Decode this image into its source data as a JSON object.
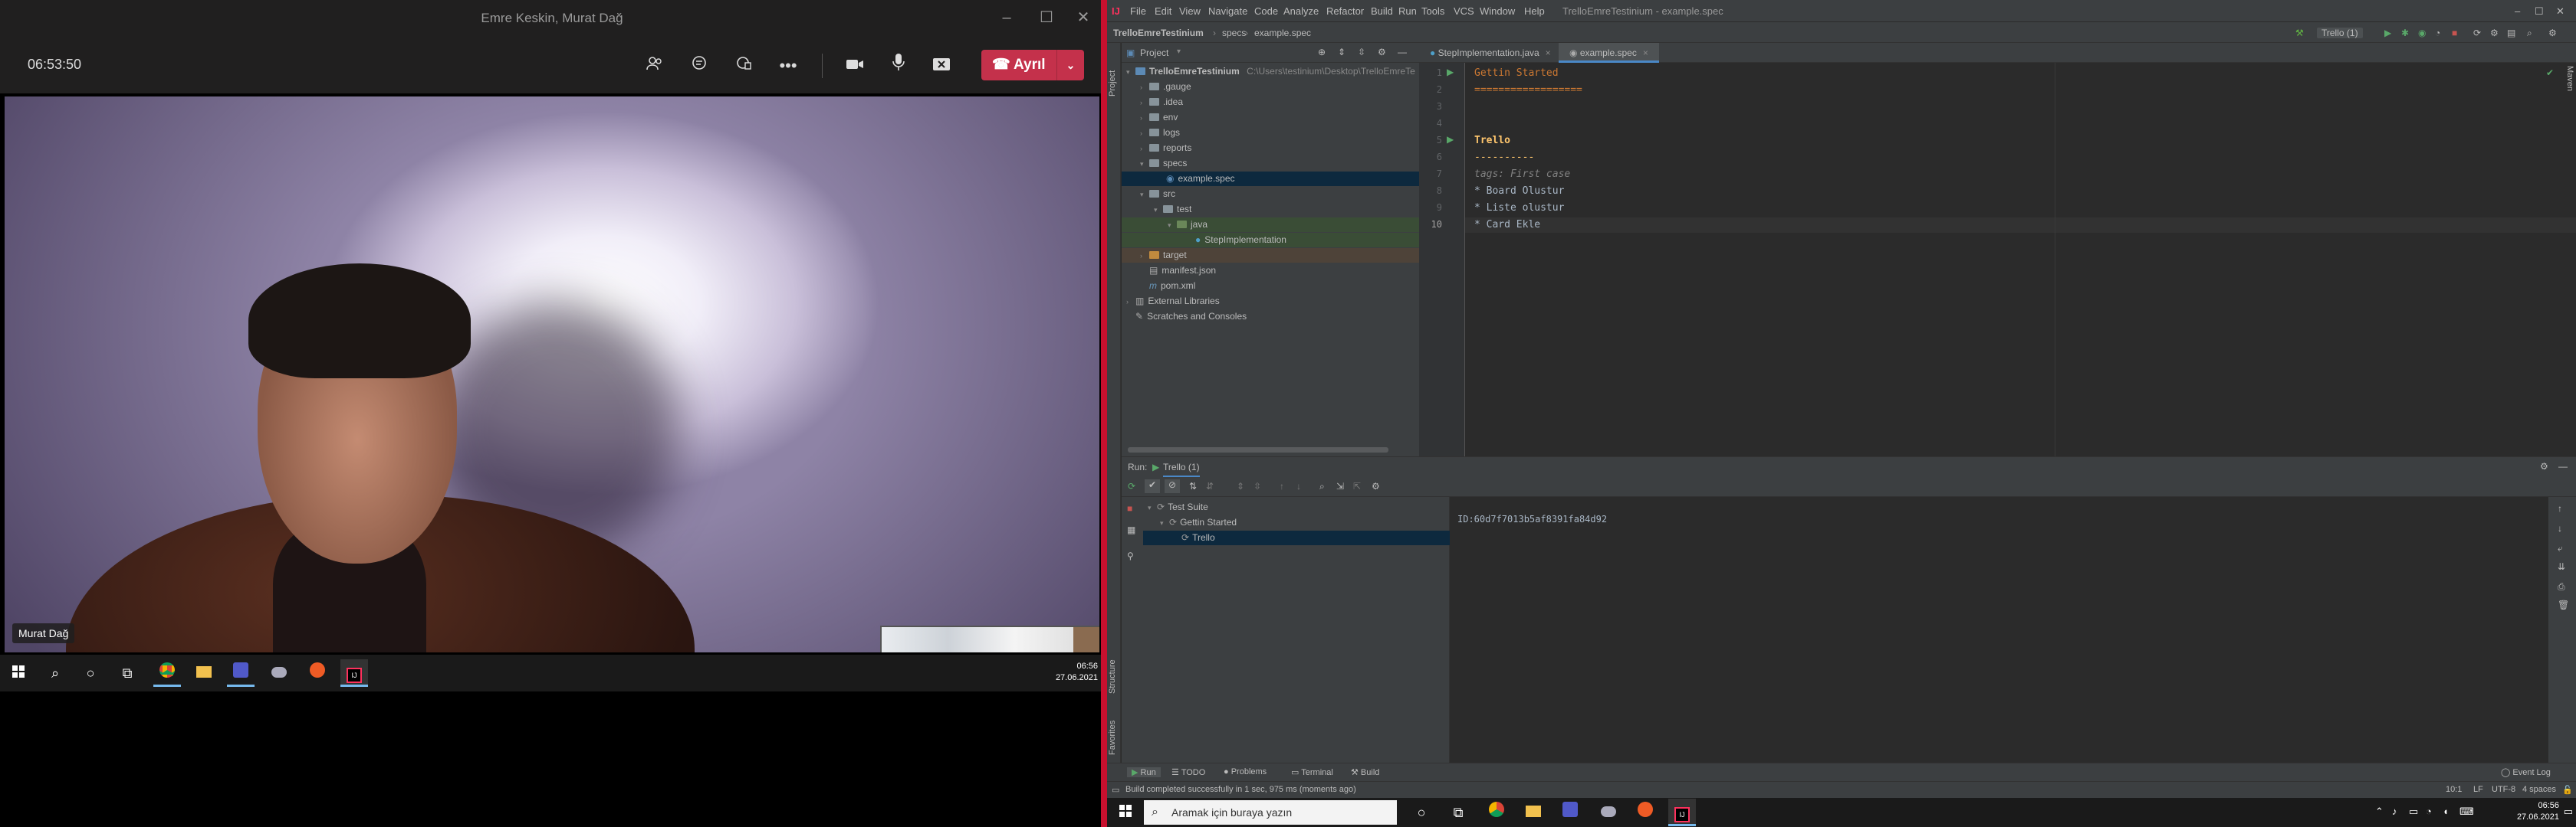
{
  "teams": {
    "window_title": "Emre Keskin, Murat Dağ",
    "call_timer": "06:53:50",
    "leave_label": "Ayrıl",
    "participant_name": "Murat Dağ",
    "icons": [
      "people-icon",
      "chat-icon",
      "reactions-icon",
      "more-icon",
      "camera-icon",
      "mic-icon",
      "share-icon",
      "phone-icon"
    ]
  },
  "left_taskbar": {
    "time": "06:56",
    "date": "27.06.2021"
  },
  "ide": {
    "window_title": "TrelloEmreTestinium - example.spec",
    "menu": [
      "File",
      "Edit",
      "View",
      "Navigate",
      "Code",
      "Analyze",
      "Refactor",
      "Build",
      "Run",
      "Tools",
      "VCS",
      "Window",
      "Help"
    ],
    "breadcrumb": [
      "TrelloEmreTestinium",
      "specs",
      "example.spec"
    ],
    "run_config": "Trello (1)",
    "project_label": "Project",
    "project_root": "TrelloEmreTestinium",
    "project_root_path": "C:\\Users\\testinium\\Desktop\\TrelloEmreTe",
    "tree": [
      {
        "label": ".gauge",
        "depth": 1,
        "kind": "folder"
      },
      {
        "label": ".idea",
        "depth": 1,
        "kind": "folder"
      },
      {
        "label": "env",
        "depth": 1,
        "kind": "folder"
      },
      {
        "label": "logs",
        "depth": 1,
        "kind": "folder"
      },
      {
        "label": "reports",
        "depth": 1,
        "kind": "folder"
      },
      {
        "label": "specs",
        "depth": 1,
        "kind": "folder-open"
      },
      {
        "label": "example.spec",
        "depth": 2,
        "kind": "file"
      },
      {
        "label": "src",
        "depth": 1,
        "kind": "folder-open"
      },
      {
        "label": "test",
        "depth": 2,
        "kind": "folder-open"
      },
      {
        "label": "java",
        "depth": 3,
        "kind": "folder-green"
      },
      {
        "label": "StepImplementation",
        "depth": 4,
        "kind": "class"
      },
      {
        "label": "target",
        "depth": 1,
        "kind": "folder-orange"
      },
      {
        "label": "manifest.json",
        "depth": 1,
        "kind": "file"
      },
      {
        "label": "pom.xml",
        "depth": 1,
        "kind": "file"
      },
      {
        "label": "External Libraries",
        "depth": 0,
        "kind": "lib"
      },
      {
        "label": "Scratches and Consoles",
        "depth": 0,
        "kind": "scratch"
      }
    ],
    "tabs": [
      "StepImplementation.java",
      "example.spec"
    ],
    "code_lines": [
      {
        "n": "1",
        "text": "Gettin Started",
        "color": "#cc7832"
      },
      {
        "n": "2",
        "text": "==================",
        "color": "#cc7832"
      },
      {
        "n": "3",
        "text": "",
        "color": "#a9b7c6"
      },
      {
        "n": "4",
        "text": "",
        "color": "#a9b7c6"
      },
      {
        "n": "5",
        "text": "Trello",
        "color": "#ffc66d"
      },
      {
        "n": "6",
        "text": "----------",
        "color": "#ffc66d"
      },
      {
        "n": "7",
        "text": "tags: First case",
        "color": "#808080"
      },
      {
        "n": "8",
        "text": "* Board Olustur",
        "color": "#a9b7c6"
      },
      {
        "n": "9",
        "text": "* Liste olustur",
        "color": "#a9b7c6"
      },
      {
        "n": "10",
        "text": "* Card Ekle",
        "color": "#a9b7c6"
      }
    ],
    "run_label": "Run:",
    "run_tab": "Trello (1)",
    "run_tree": [
      {
        "label": "Test Suite",
        "depth": 0
      },
      {
        "label": "Gettin Started",
        "depth": 1
      },
      {
        "label": "Trello",
        "depth": 2
      }
    ],
    "console_output": "ID:60d7f7013b5af8391fa84d92",
    "bottom_tabs": [
      "Run",
      "TODO",
      "Problems",
      "Terminal",
      "Build"
    ],
    "event_log": "Event Log",
    "status_message": "Build completed successfully in 1 sec, 975 ms (moments ago)",
    "status_right": [
      "10:1",
      "LF",
      "UTF-8",
      "4 spaces"
    ],
    "vertical_tabs": [
      "Project",
      "Structure",
      "Favorites"
    ],
    "right_vertical_tab": "Maven"
  },
  "right_taskbar": {
    "search_placeholder": "Aramak için buraya yazın",
    "time": "06:56",
    "date": "27.06.2021"
  },
  "colors": {
    "teams_leave": "#c4314b",
    "ide_bg": "#2b2b2b",
    "ide_panel": "#3c3f41",
    "divider": "#c8102e"
  }
}
